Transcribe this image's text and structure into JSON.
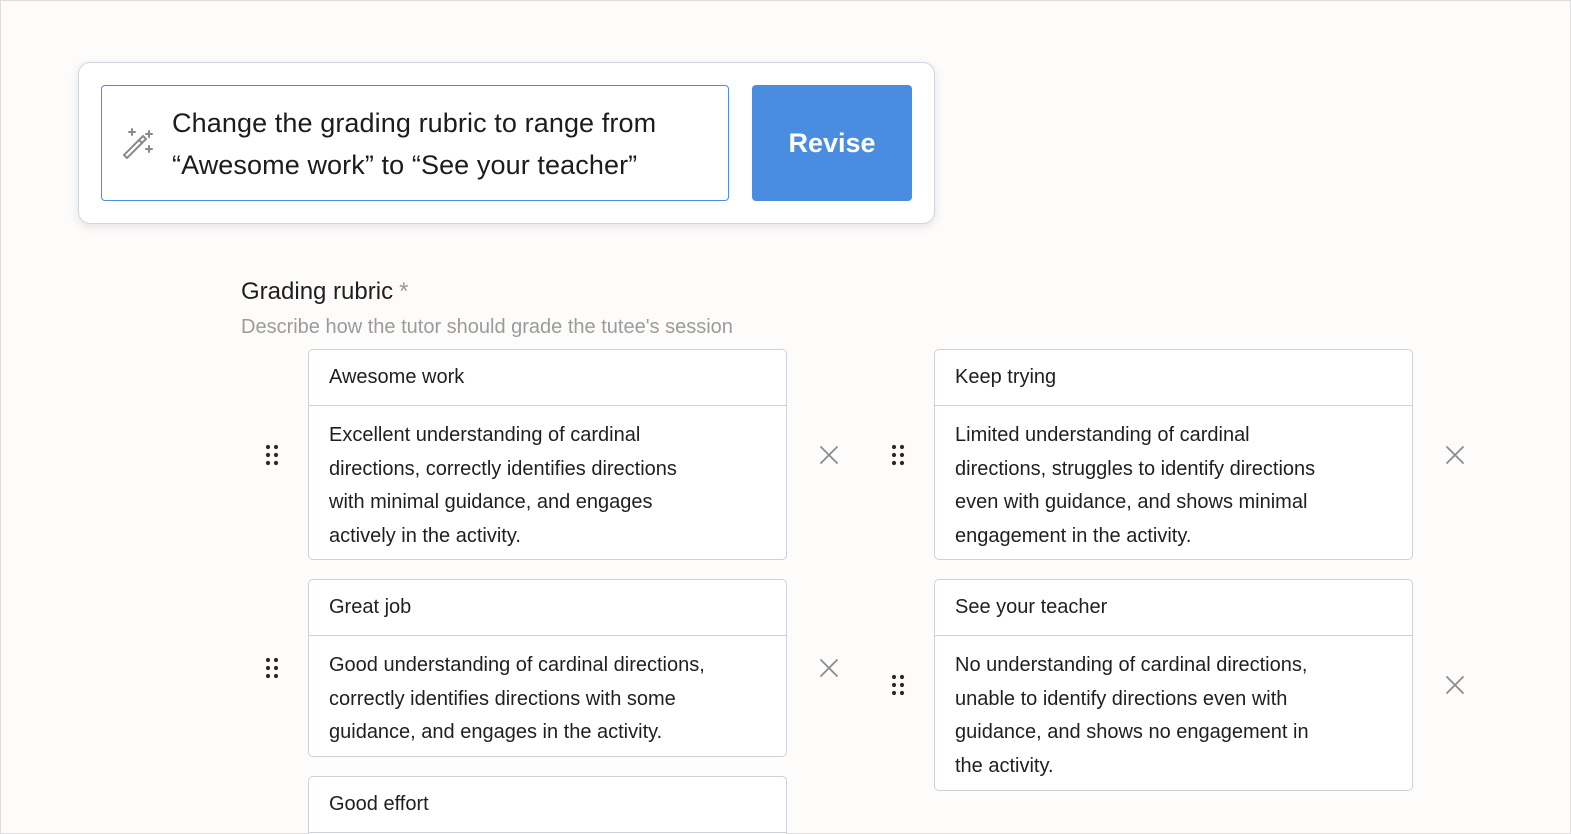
{
  "revise": {
    "prompt_line1": "Change the grading rubric to range from",
    "prompt_line2": "“Awesome work” to “See your teacher”",
    "button_label": "Revise",
    "icon": "magic-wand-icon"
  },
  "rubric": {
    "title": "Grading rubric",
    "required_marker": "*",
    "description": "Describe how the tutor should grade the tutee's session",
    "items": [
      {
        "title": "Awesome work",
        "lines": [
          "Excellent understanding of cardinal",
          "directions, correctly identifies directions",
          "with minimal guidance, and engages",
          "actively in the activity."
        ]
      },
      {
        "title": "Keep trying",
        "lines": [
          "Limited understanding of cardinal",
          "directions, struggles to identify directions",
          "even with guidance, and shows minimal",
          "engagement in the activity."
        ]
      },
      {
        "title": "Great job",
        "lines": [
          "Good understanding of cardinal directions,",
          "correctly identifies directions with some",
          "guidance, and engages in the activity."
        ]
      },
      {
        "title": "See your teacher",
        "lines": [
          "No understanding of cardinal directions,",
          "unable to identify directions even with",
          "guidance, and shows no engagement in",
          "the activity."
        ]
      },
      {
        "title": "Good effort",
        "lines": []
      }
    ]
  },
  "icons": {
    "drag": "drag-handle-icon",
    "remove": "close-icon"
  },
  "colors": {
    "accent": "#4a8de0",
    "border": "#cdd2d8",
    "muted_text": "#9b9b9b",
    "background": "#fdfcfb"
  }
}
